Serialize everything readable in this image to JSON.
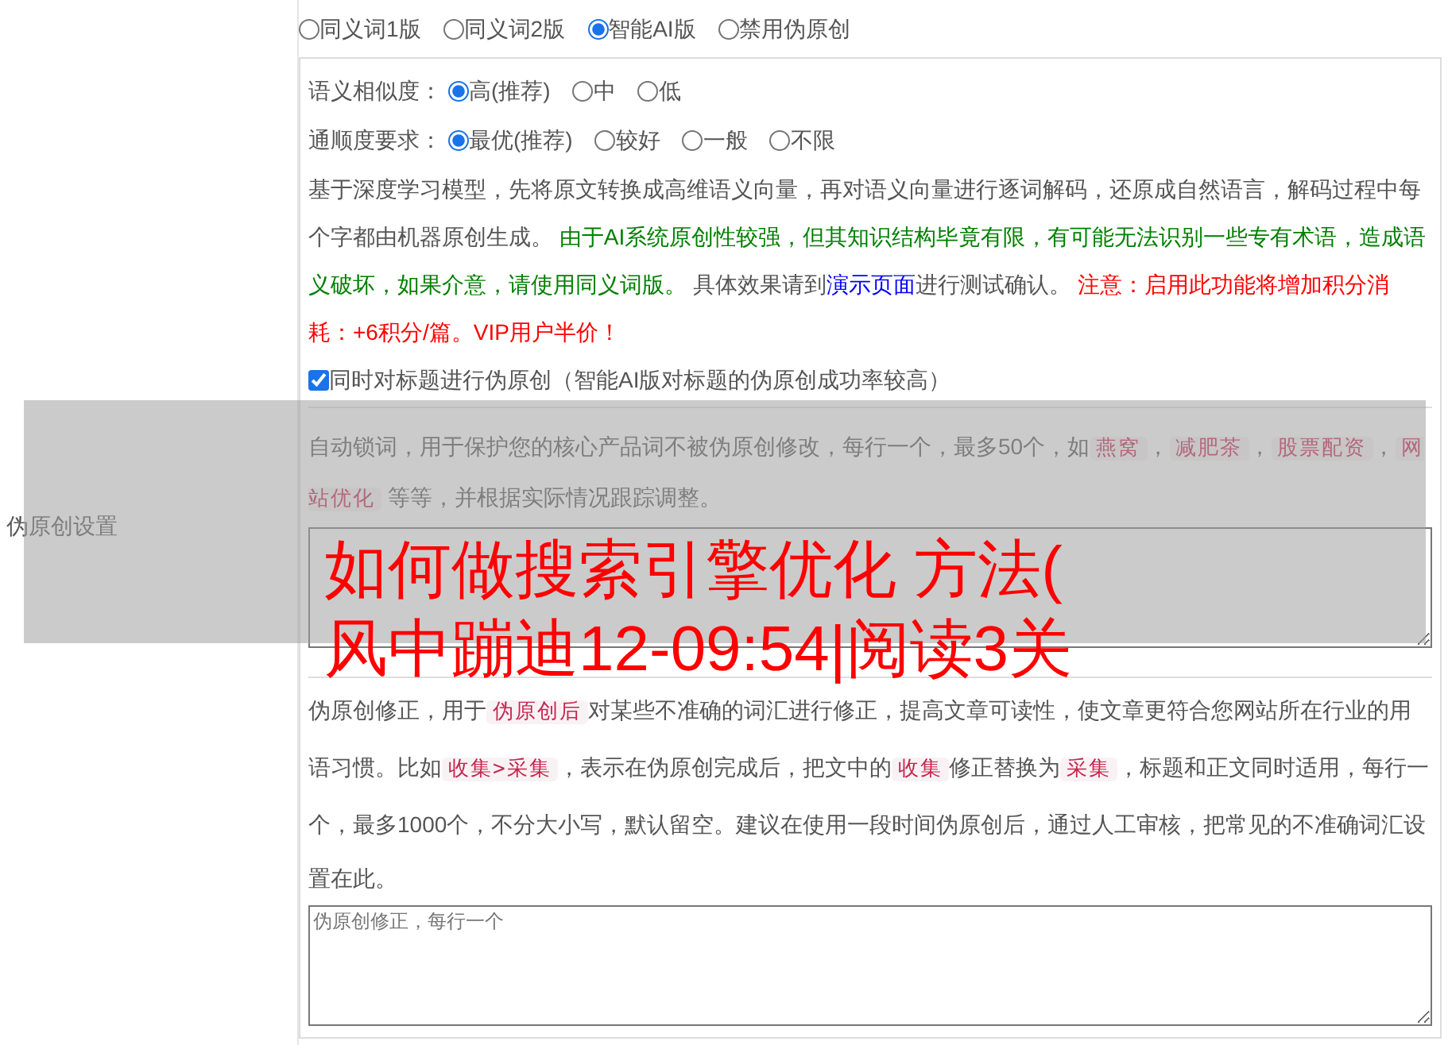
{
  "mode_options": [
    {
      "label": "同义词1版",
      "selected": false
    },
    {
      "label": "同义词2版",
      "selected": false
    },
    {
      "label": "智能AI版",
      "selected": true
    },
    {
      "label": "禁用伪原创",
      "selected": false
    }
  ],
  "similarity": {
    "label": "语义相似度：",
    "options": [
      {
        "label": "高(推荐)",
        "selected": true
      },
      {
        "label": "中",
        "selected": false
      },
      {
        "label": "低",
        "selected": false
      }
    ]
  },
  "fluency": {
    "label": "通顺度要求：",
    "options": [
      {
        "label": "最优(推荐)",
        "selected": true
      },
      {
        "label": "较好",
        "selected": false
      },
      {
        "label": "一般",
        "selected": false
      },
      {
        "label": "不限",
        "selected": false
      }
    ]
  },
  "description": [
    {
      "kind": "plain",
      "text": "基于深度学习模型，先将原文转换成高维语义向量，再对语义向量进行逐词解码，还原成自然语言，解码过程中每个字都由机器原创生成。 "
    },
    {
      "kind": "green",
      "text": "由于AI系统原创性较强，但其知识结构毕竟有限，有可能无法识别一些专有术语，造成语义破坏，如果介意，请使用同义词版。"
    },
    {
      "kind": "plain",
      "text": " 具体效果请到"
    },
    {
      "kind": "link",
      "text": "演示页面"
    },
    {
      "kind": "plain",
      "text": "进行测试确认。 "
    },
    {
      "kind": "red",
      "text": "注意：启用此功能将增加积分消耗：+6积分/篇。VIP用户半价！"
    }
  ],
  "title_option": {
    "label": "同时对标题进行伪原创（智能AI版对标题的伪原创成功率较高）",
    "checked": true
  },
  "section_label": "伪原创设置",
  "lock_words": {
    "description": [
      {
        "kind": "plain",
        "text": "自动锁词，用于保护您的核心产品词不被伪原创修改，每行一个，最多50个，如"
      },
      {
        "kind": "code",
        "text": "燕窝"
      },
      {
        "kind": "plain",
        "text": "，"
      },
      {
        "kind": "code",
        "text": "减肥茶"
      },
      {
        "kind": "plain",
        "text": "，"
      },
      {
        "kind": "code",
        "text": "股票配资"
      },
      {
        "kind": "plain",
        "text": "，"
      },
      {
        "kind": "code",
        "text": "网站优化"
      },
      {
        "kind": "plain",
        "text": " 等等，并根据实际情况跟踪调整。"
      }
    ]
  },
  "corrections": {
    "description": [
      {
        "kind": "plain",
        "text": "伪原创修正，用于"
      },
      {
        "kind": "code",
        "text": "伪原创后"
      },
      {
        "kind": "plain",
        "text": "对某些不准确的词汇进行修正，提高文章可读性，使文章更符合您网站所在行业的用语习惯。比如"
      },
      {
        "kind": "code",
        "text": "收集>采集"
      },
      {
        "kind": "plain",
        "text": "，表示在伪原创完成后，把文中的"
      },
      {
        "kind": "code",
        "text": "收集"
      },
      {
        "kind": "plain",
        "text": "修正替换为"
      },
      {
        "kind": "code",
        "text": "采集"
      },
      {
        "kind": "plain",
        "text": "，标题和正文同时适用，每行一个，最多1000个，不分大小写，默认留空。建议在使用一段时间伪原创后，通过人工审核，把常见的不准确词汇设置在此。"
      }
    ],
    "placeholder": "伪原创修正，每行一个"
  },
  "overlay": {
    "title_lines": [
      "如何做搜索引擎优化 方法(",
      "风中蹦迪12-09:54|阅读3关"
    ]
  }
}
